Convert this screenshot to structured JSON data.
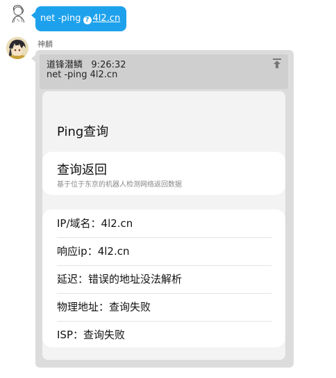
{
  "top_message": {
    "command": "net -ping",
    "link": "4l2.cn"
  },
  "sender_name": "神麟",
  "card": {
    "quote_author": "道锋潜鳞",
    "quote_time": "9:26:32",
    "quote_text": "net -ping 4l2.cn",
    "title": "Ping查询",
    "section_title": "查询返回",
    "section_subtitle": "基于位于东京的机器人检测网络返回数据",
    "rows": [
      "IP/域名：4l2.cn",
      "响应ip：4l2.cn",
      "延迟：错误的地址没法解析",
      "物理地址：查询失败",
      "ISP：查询失败"
    ]
  },
  "colors": {
    "bubble_blue": "#1ea1ec",
    "card_gray": "#dcdcdc",
    "panel_bg": "#f3f3f3"
  },
  "icons": [
    "avatar-sketch",
    "avatar-anime",
    "help-circle-icon",
    "pin-top-icon"
  ]
}
